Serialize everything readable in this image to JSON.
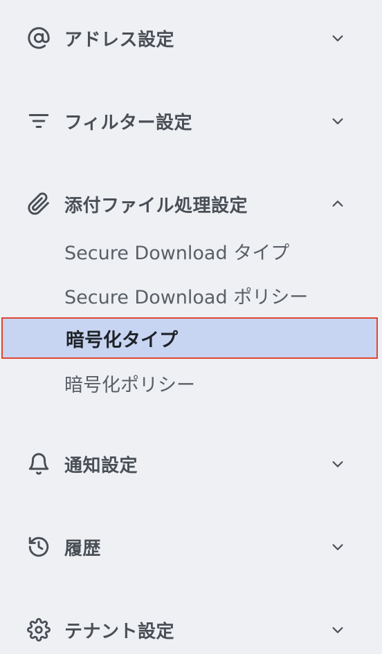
{
  "sections": [
    {
      "label": "アドレス設定",
      "icon": "at-sign-icon",
      "expanded": false
    },
    {
      "label": "フィルター設定",
      "icon": "filter-icon",
      "expanded": false
    },
    {
      "label": "添付ファイル処理設定",
      "icon": "paperclip-icon",
      "expanded": true,
      "items": [
        {
          "label": "Secure Download タイプ",
          "active": false
        },
        {
          "label": "Secure Download ポリシー",
          "active": false
        },
        {
          "label": "暗号化タイプ",
          "active": true
        },
        {
          "label": "暗号化ポリシー",
          "active": false
        }
      ]
    },
    {
      "label": "通知設定",
      "icon": "bell-icon",
      "expanded": false
    },
    {
      "label": "履歴",
      "icon": "history-icon",
      "expanded": false
    },
    {
      "label": "テナント設定",
      "icon": "gear-icon",
      "expanded": false
    }
  ],
  "colors": {
    "background": "#eef0f4",
    "active_background": "#c8d5f2",
    "active_border": "#e0442f",
    "text": "#4a4f56",
    "active_text": "#1e2328"
  }
}
